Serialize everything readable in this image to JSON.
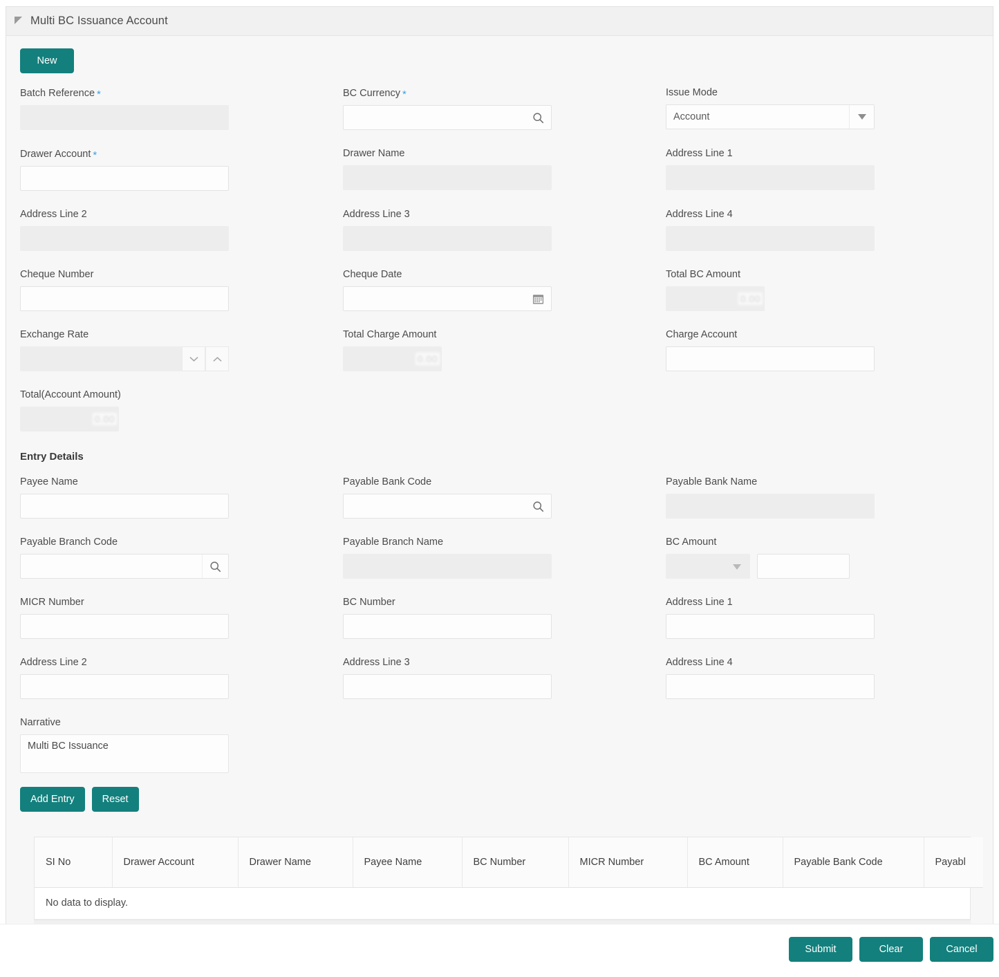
{
  "panel": {
    "title": "Multi BC Issuance Account",
    "collapse_icon": "collapse-triangle-icon"
  },
  "toolbar": {
    "new_label": "New"
  },
  "colors": {
    "accent_teal": "#13807d",
    "required_asterisk": "#3aa3dd",
    "panel_bg": "#f7f7f7",
    "disabled_field": "#ededed",
    "scrollbar_thumb": "#6b6165"
  },
  "main_form": {
    "batch_reference": {
      "label": "Batch Reference",
      "required": true,
      "value": "",
      "state": "disabled"
    },
    "bc_currency": {
      "label": "BC Currency",
      "required": true,
      "value": "",
      "state": "enabled",
      "icon": "search-icon"
    },
    "issue_mode": {
      "label": "Issue Mode",
      "required": false,
      "value": "Account",
      "state": "enabled",
      "icon": "chevron-down-icon"
    },
    "drawer_account": {
      "label": "Drawer Account",
      "required": true,
      "value": "",
      "state": "enabled"
    },
    "drawer_name": {
      "label": "Drawer Name",
      "required": false,
      "value": "",
      "state": "disabled"
    },
    "address_line_1": {
      "label": "Address Line 1",
      "required": false,
      "value": "",
      "state": "disabled"
    },
    "address_line_2": {
      "label": "Address Line 2",
      "required": false,
      "value": "",
      "state": "disabled"
    },
    "address_line_3": {
      "label": "Address Line 3",
      "required": false,
      "value": "",
      "state": "disabled"
    },
    "address_line_4": {
      "label": "Address Line 4",
      "required": false,
      "value": "",
      "state": "disabled"
    },
    "cheque_number": {
      "label": "Cheque Number",
      "required": false,
      "value": "",
      "state": "enabled"
    },
    "cheque_date": {
      "label": "Cheque Date",
      "required": false,
      "value": "",
      "state": "enabled",
      "icon": "calendar-icon"
    },
    "total_bc_amount": {
      "label": "Total BC Amount",
      "required": false,
      "value": "0.00",
      "state": "disabled",
      "redacted": true
    },
    "exchange_rate": {
      "label": "Exchange Rate",
      "required": false,
      "value": "",
      "state": "disabled",
      "icon": "spinner-up-down-icon"
    },
    "total_charge_amount": {
      "label": "Total Charge Amount",
      "required": false,
      "value": "0.00",
      "state": "disabled",
      "redacted": true
    },
    "charge_account": {
      "label": "Charge Account",
      "required": false,
      "value": "",
      "state": "enabled"
    },
    "total_account_amount": {
      "label": "Total(Account Amount)",
      "required": false,
      "value": "0.00",
      "state": "disabled",
      "redacted": true
    }
  },
  "entry_details": {
    "heading": "Entry Details",
    "payee_name": {
      "label": "Payee Name",
      "required": false,
      "value": "",
      "state": "enabled"
    },
    "payable_bank_code": {
      "label": "Payable Bank Code",
      "required": false,
      "value": "",
      "state": "enabled",
      "icon": "search-icon"
    },
    "payable_bank_name": {
      "label": "Payable Bank Name",
      "required": false,
      "value": "",
      "state": "disabled"
    },
    "payable_branch_code": {
      "label": "Payable Branch Code",
      "required": false,
      "value": "",
      "state": "enabled",
      "icon": "search-icon"
    },
    "payable_branch_name": {
      "label": "Payable Branch Name",
      "required": false,
      "value": "",
      "state": "disabled"
    },
    "bc_amount": {
      "label": "BC Amount",
      "required": false,
      "currency_value": "",
      "amount_value": "",
      "state": "enabled",
      "icon": "chevron-down-icon"
    },
    "micr_number": {
      "label": "MICR Number",
      "required": false,
      "value": "",
      "state": "enabled"
    },
    "bc_number": {
      "label": "BC Number",
      "required": false,
      "value": "",
      "state": "enabled"
    },
    "address_line_1": {
      "label": "Address Line 1",
      "required": false,
      "value": "",
      "state": "enabled"
    },
    "address_line_2": {
      "label": "Address Line 2",
      "required": false,
      "value": "",
      "state": "enabled"
    },
    "address_line_3": {
      "label": "Address Line 3",
      "required": false,
      "value": "",
      "state": "enabled"
    },
    "address_line_4": {
      "label": "Address Line 4",
      "required": false,
      "value": "",
      "state": "enabled"
    },
    "narrative": {
      "label": "Narrative",
      "required": false,
      "value": "Multi BC Issuance",
      "state": "enabled"
    },
    "add_entry_label": "Add Entry",
    "reset_label": "Reset"
  },
  "entries_table": {
    "columns": [
      "SI No",
      "Drawer Account",
      "Drawer Name",
      "Payee Name",
      "BC Number",
      "MICR Number",
      "BC Amount",
      "Payable Bank Code",
      "Payabl"
    ],
    "rows": [],
    "empty_message": "No data to display.",
    "scrollbar": "horizontal-scrollbar"
  },
  "footer": {
    "submit_label": "Submit",
    "clear_label": "Clear",
    "cancel_label": "Cancel"
  }
}
